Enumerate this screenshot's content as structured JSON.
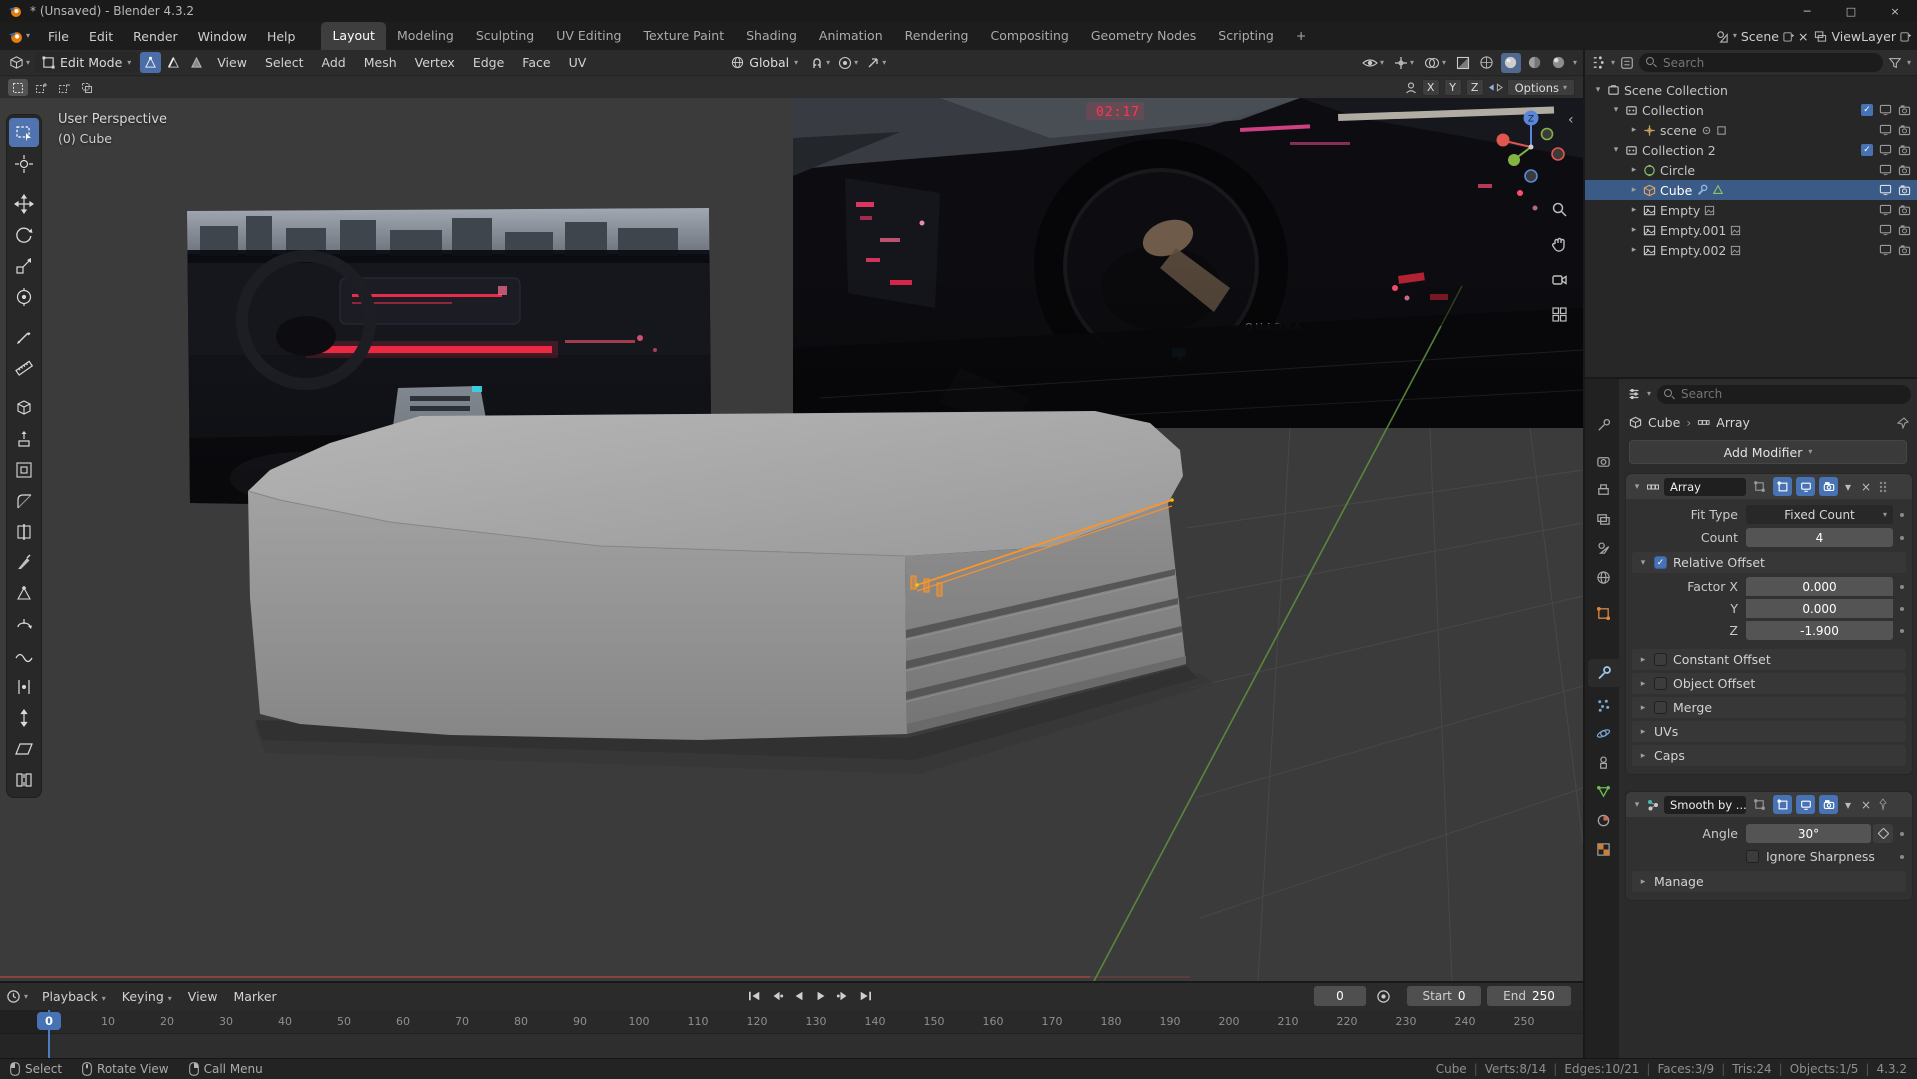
{
  "window": {
    "title": "* (Unsaved) - Blender 4.3.2"
  },
  "icons": {
    "chevron_down": "▾",
    "chevron_right": "▸",
    "breadcrumb_sep": "›",
    "close": "×",
    "minimize": "─",
    "maximize": "□",
    "check": "✓",
    "plus": "+",
    "collapse_left": "‹"
  },
  "topbar": {
    "menus": [
      "File",
      "Edit",
      "Render",
      "Window",
      "Help"
    ],
    "workspaces": [
      "Layout",
      "Modeling",
      "Sculpting",
      "UV Editing",
      "Texture Paint",
      "Shading",
      "Animation",
      "Rendering",
      "Compositing",
      "Geometry Nodes",
      "Scripting"
    ],
    "scene_name": "Scene",
    "view_layer_name": "ViewLayer"
  },
  "viewport": {
    "header": {
      "mode": "Edit Mode",
      "menus": [
        "View",
        "Select",
        "Add",
        "Mesh",
        "Vertex",
        "Edge",
        "Face",
        "UV"
      ],
      "orientation": "Global",
      "options_label": "Options",
      "axis_labels": [
        "X",
        "Y",
        "Z"
      ]
    },
    "overlay": {
      "perspective": "User Perspective",
      "object": "(0) Cube",
      "gizmo_z": "Z"
    },
    "scene_texts": {
      "clock": "02:17",
      "brand": "QUADRA"
    }
  },
  "outliner": {
    "search_placeholder": "Search",
    "items": [
      {
        "label": "Scene Collection"
      },
      {
        "label": "Collection"
      },
      {
        "label": "scene"
      },
      {
        "label": "Collection 2"
      },
      {
        "label": "Circle"
      },
      {
        "label": "Cube"
      },
      {
        "label": "Empty"
      },
      {
        "label": "Empty.001"
      },
      {
        "label": "Empty.002"
      }
    ]
  },
  "properties": {
    "search_placeholder": "Search",
    "breadcrumb": {
      "object": "Cube",
      "modifier": "Array"
    },
    "add_modifier_label": "Add Modifier",
    "array": {
      "name": "Array",
      "fit_type_label": "Fit Type",
      "fit_type_value": "Fixed Count",
      "count_label": "Count",
      "count_value": "4",
      "relative_offset_label": "Relative Offset",
      "factor_x_label": "Factor X",
      "factor_x_value": "0.000",
      "factor_y_label": "Y",
      "factor_y_value": "0.000",
      "factor_z_label": "Z",
      "factor_z_value": "-1.900",
      "constant_offset_label": "Constant Offset",
      "object_offset_label": "Object Offset",
      "merge_label": "Merge",
      "uvs_label": "UVs",
      "caps_label": "Caps"
    },
    "smooth": {
      "name": "Smooth by ...",
      "angle_label": "Angle",
      "angle_value": "30°",
      "ignore_sharpness_label": "Ignore Sharpness",
      "manage_label": "Manage"
    }
  },
  "timeline": {
    "menus": [
      "Playback",
      "Keying",
      "View",
      "Marker"
    ],
    "current_frame": "0",
    "playhead_label": "0",
    "start_label": "Start",
    "start_value": "0",
    "end_label": "End",
    "end_value": "250",
    "ticks": [
      "0",
      "10",
      "20",
      "30",
      "40",
      "50",
      "60",
      "70",
      "80",
      "90",
      "100",
      "110",
      "120",
      "130",
      "140",
      "150",
      "160",
      "170",
      "180",
      "190",
      "200",
      "210",
      "220",
      "230",
      "240",
      "250"
    ]
  },
  "statusbar": {
    "hints": [
      "Select",
      "Rotate View",
      "Call Menu"
    ],
    "stats": [
      "Cube",
      "Verts:8/14",
      "Edges:10/21",
      "Faces:3/9",
      "Tris:24",
      "Objects:1/5",
      "4.3.2"
    ]
  }
}
